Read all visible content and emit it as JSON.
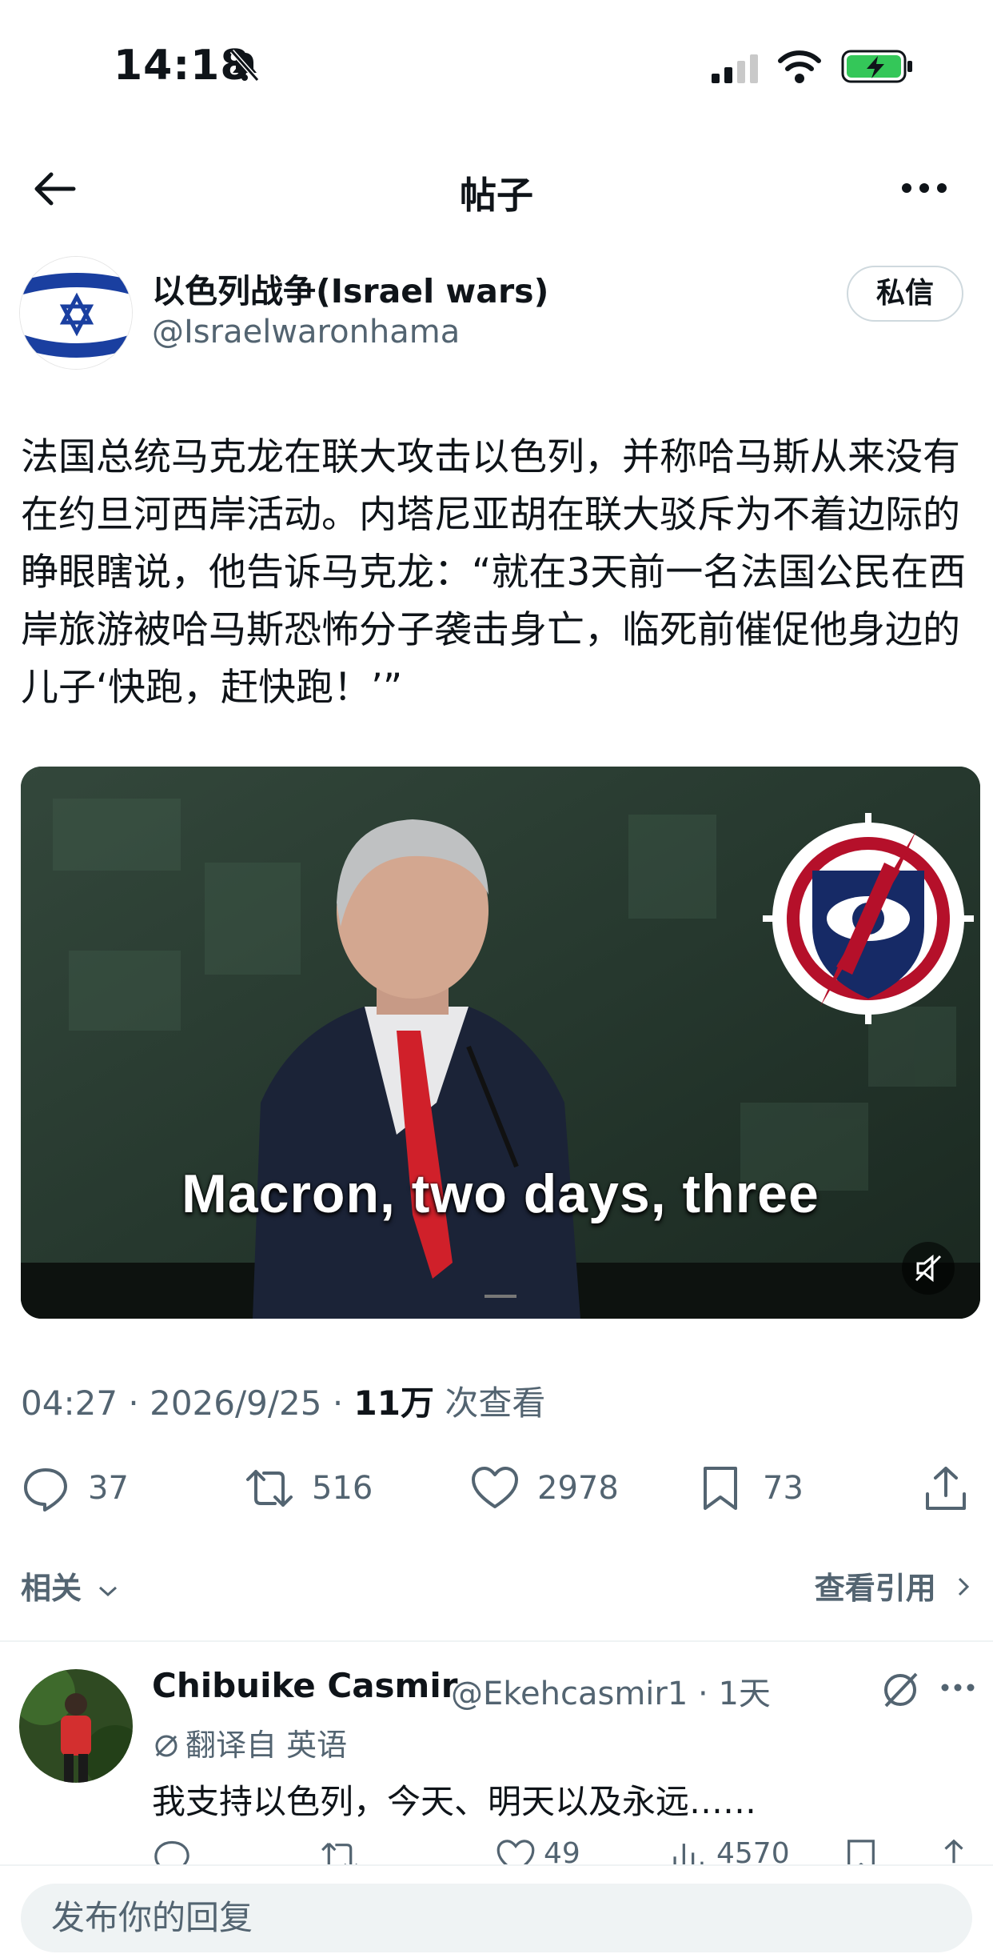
{
  "status_bar": {
    "time": "14:18",
    "bell": "bell-muted-icon",
    "battery": "battery-charging-icon"
  },
  "header": {
    "back_icon": "arrow-left-icon",
    "title": "帖子",
    "more_icon": "more-horizontal-icon"
  },
  "author": {
    "name": "以色列战争(Israel wars)",
    "handle": "@Israelwaronhama",
    "dm_label": "私信"
  },
  "post": {
    "text": "法国总统马克龙在联大攻击以色列，并称哈马斯从来没有在约旦河西岸活动。内塔尼亚胡在联大驳斥为不着边际的睁眼瞎说，他告诉马克龙：“就在3天前一名法国公民在西岸旅游被哈马斯恐怖分子袭击身亡，临死前催促他身边的儿子‘快跑，赶快跑！’”",
    "video_caption": "Macron, two days, three",
    "mute_icon": "volume-muted-icon"
  },
  "meta": {
    "time": "04:27",
    "date": "2026/9/25",
    "views": "11万",
    "views_label": "次查看"
  },
  "actions": {
    "replies": "37",
    "reposts": "516",
    "likes": "2978",
    "bookmarks": "73"
  },
  "related": {
    "label": "相关",
    "quotes_label": "查看引用"
  },
  "reply": {
    "name": "Chibuike Casmir",
    "handle": "@Ekehcasmir1",
    "age": "1天",
    "translated": "翻译自 英语",
    "text": "我支持以色列，今天、明天以及永远……",
    "likes": "49",
    "views": "4570"
  },
  "compose": {
    "placeholder": "发布你的回复"
  },
  "colors": {
    "text": "#0f1419",
    "secondary": "#536471",
    "divider": "#eff3f4",
    "flag_blue": "#1a3fa0",
    "tie_red": "#d0202a"
  }
}
